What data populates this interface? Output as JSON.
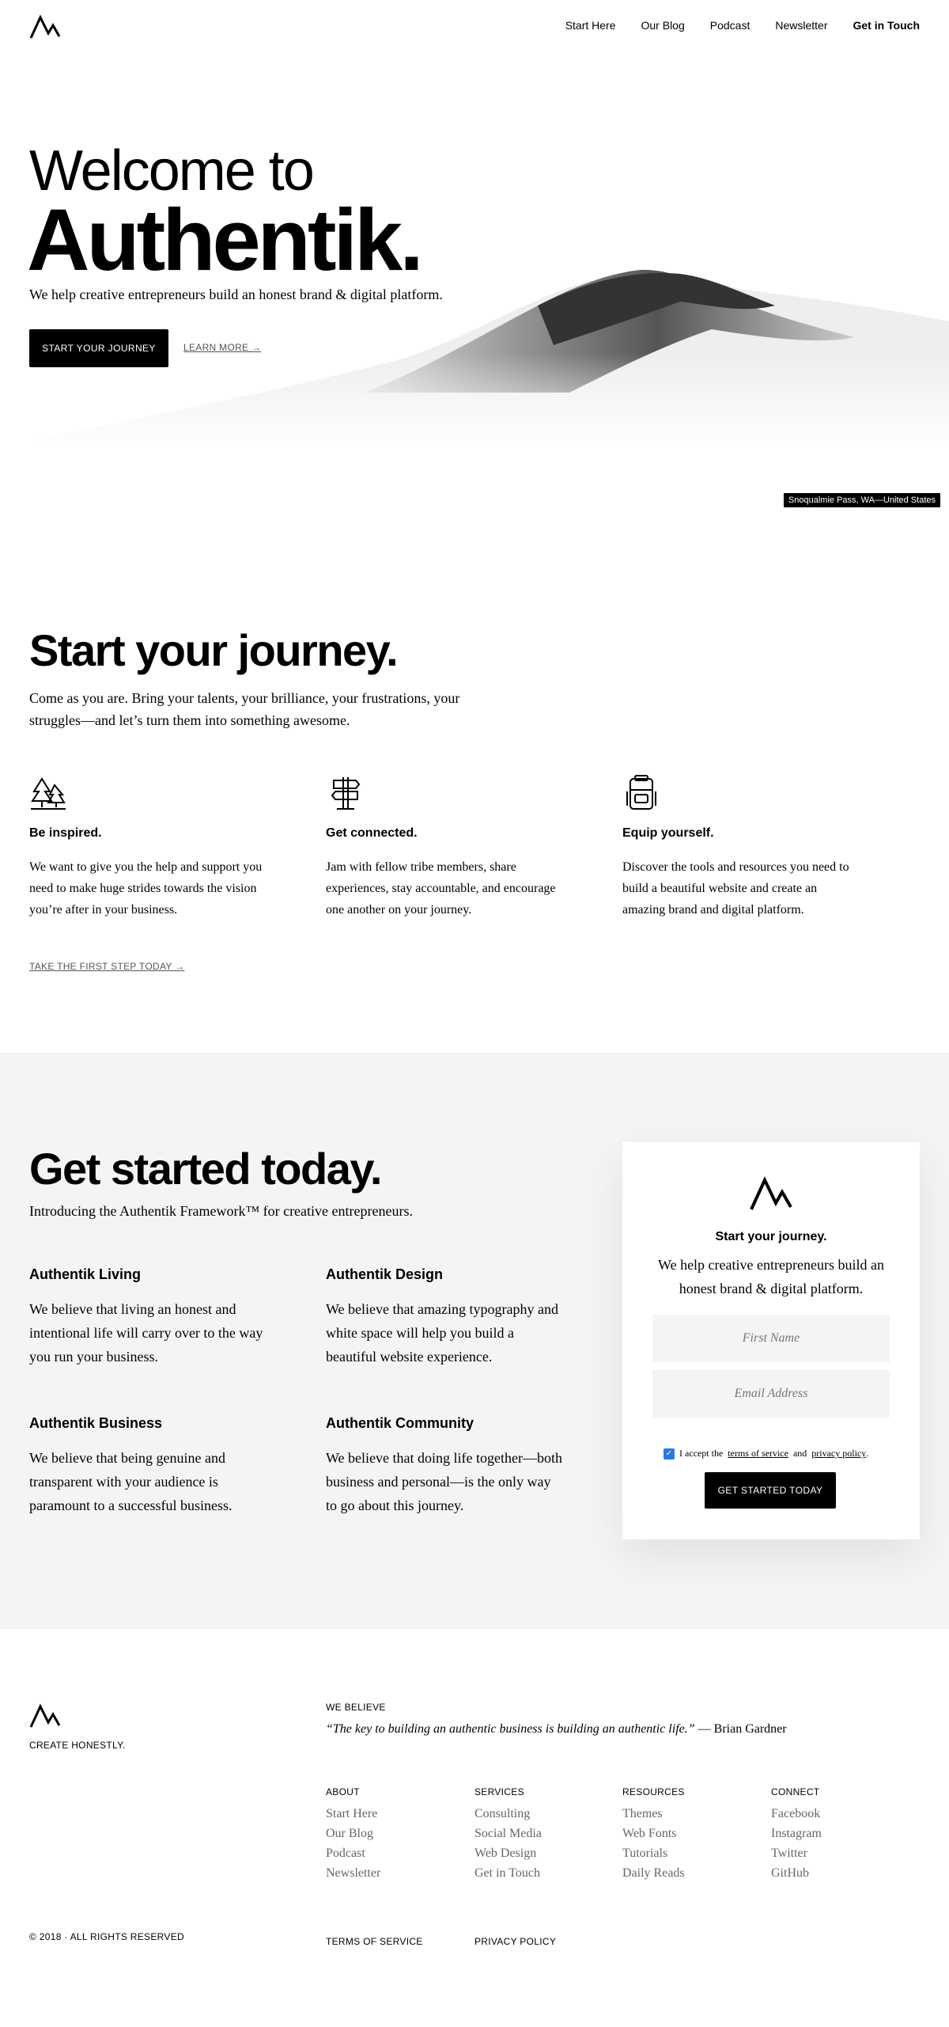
{
  "nav": {
    "items": [
      {
        "label": "Start Here",
        "strong": false
      },
      {
        "label": "Our Blog",
        "strong": false
      },
      {
        "label": "Podcast",
        "strong": false
      },
      {
        "label": "Newsletter",
        "strong": false
      },
      {
        "label": "Get in Touch",
        "strong": true
      }
    ]
  },
  "hero": {
    "welcome": "Welcome to",
    "brand": "Authentik.",
    "tagline": "We help creative entrepreneurs build an honest brand & digital platform.",
    "cta": "START YOUR JOURNEY",
    "link": "LEARN MORE →",
    "caption": "Snoqualmie Pass, WA—United States"
  },
  "journey": {
    "title": "Start your journey.",
    "intro": "Come as you are. Bring your talents, your brilliance, your frustrations, your struggles—and let’s turn them into something awesome.",
    "columns": [
      {
        "icon": "trees-icon",
        "title": "Be inspired.",
        "text": "We want to give you the help and support you need to make huge strides towards the vision you’re after in your business."
      },
      {
        "icon": "signpost-icon",
        "title": "Get connected.",
        "text": "Jam with fellow tribe members, share experiences, stay accountable, and encourage one another on your journey."
      },
      {
        "icon": "backpack-icon",
        "title": "Equip yourself.",
        "text": "Discover the tools and resources you need to build a beautiful website and create an amazing brand and digital platform."
      }
    ],
    "link": "TAKE THE FIRST STEP TODAY →"
  },
  "started": {
    "title": "Get started today.",
    "subtitle": "Introducing the Authentik Framework™ for creative entrepreneurs.",
    "features": [
      {
        "title": "Authentik Living",
        "text": "We believe that living an honest and intentional life will carry over to the way you run your business."
      },
      {
        "title": "Authentik Design",
        "text": "We believe that amazing typography and white space will help you build a beautiful website experience."
      },
      {
        "title": "Authentik Business",
        "text": "We believe that being genuine and transparent with your audience is paramount to a successful business."
      },
      {
        "title": "Authentik Community",
        "text": "We believe that doing life together—both business and personal—is the only way to go about this journey."
      }
    ],
    "card": {
      "title": "Start your journey.",
      "text": "We help creative entrepreneurs build an honest brand & digital platform.",
      "first_name_placeholder": "First Name",
      "email_placeholder": "Email Address",
      "accept_prefix": "I accept the",
      "terms": "terms of service",
      "and": "and",
      "privacy": "privacy policy",
      "period": ".",
      "button": "GET STARTED TODAY"
    }
  },
  "footer": {
    "motto": "CREATE HONESTLY.",
    "we_believe": "WE BELIEVE",
    "quote": "“The key to building an authentic business is building an authentic life.”",
    "quote_author": " — Brian Gardner",
    "columns": [
      {
        "title": "ABOUT",
        "links": [
          "Start Here",
          "Our Blog",
          "Podcast",
          "Newsletter"
        ]
      },
      {
        "title": "SERVICES",
        "links": [
          "Consulting",
          "Social Media",
          "Web Design",
          "Get in Touch"
        ]
      },
      {
        "title": "RESOURCES",
        "links": [
          "Themes",
          "Web Fonts",
          "Tutorials",
          "Daily Reads"
        ]
      },
      {
        "title": "CONNECT",
        "links": [
          "Facebook",
          "Instagram",
          "Twitter",
          "GitHub"
        ]
      }
    ],
    "copyright": "© 2018 · ALL RIGHTS RESERVED",
    "terms": "TERMS OF SERVICE",
    "privacy": "PRIVACY POLICY"
  }
}
